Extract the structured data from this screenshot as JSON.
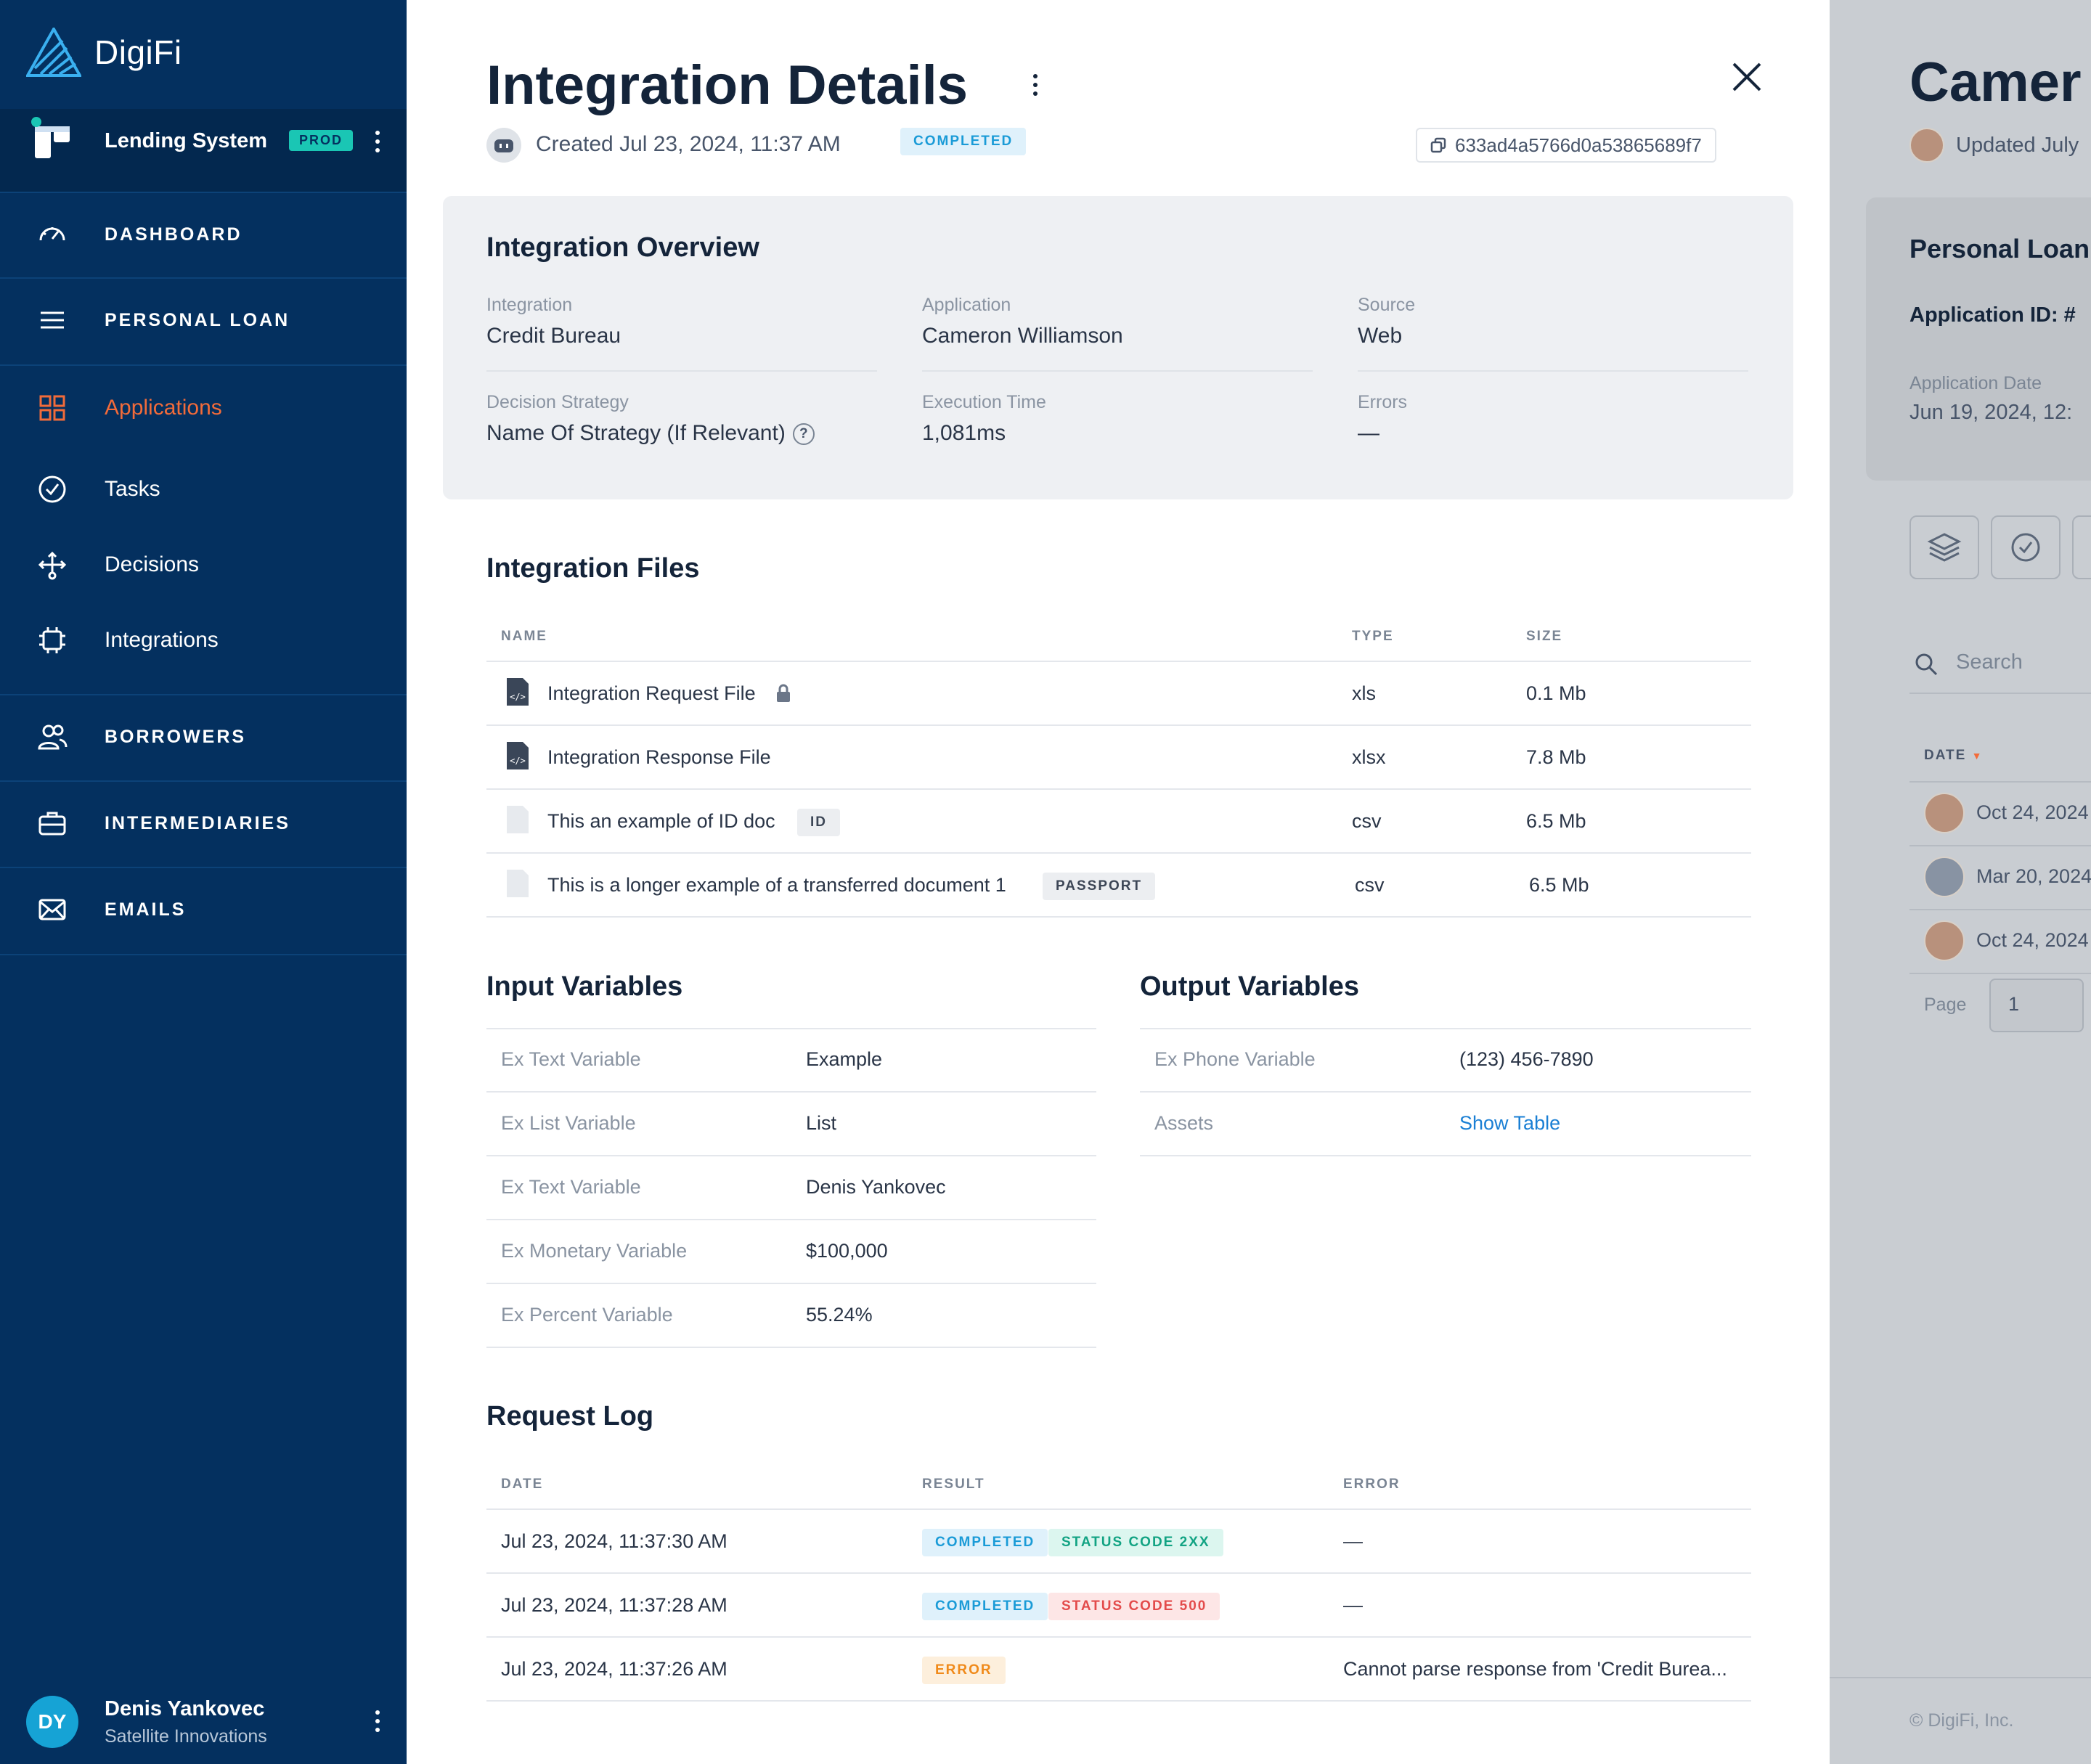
{
  "sidebar": {
    "logo_text": "DigiFi",
    "system_name": "Lending System",
    "system_badge": "PROD",
    "nav": {
      "dashboard": "DASHBOARD",
      "personal_loan": "PERSONAL LOAN",
      "applications": "Applications",
      "tasks": "Tasks",
      "decisions": "Decisions",
      "integrations": "Integrations",
      "borrowers": "BORROWERS",
      "intermediaries": "INTERMEDIARIES",
      "emails": "EMAILS"
    },
    "user": {
      "initials": "DY",
      "name": "Denis Yankovec",
      "org": "Satellite Innovations"
    }
  },
  "detail": {
    "title": "Integration Details",
    "created": "Created Jul 23, 2024, 11:37 AM",
    "status": "COMPLETED",
    "id": "633ad4a5766d0a53865689f7",
    "overview": {
      "title": "Integration Overview",
      "fields": [
        {
          "label": "Integration",
          "value": "Credit Bureau"
        },
        {
          "label": "Application",
          "value": "Cameron Williamson"
        },
        {
          "label": "Source",
          "value": "Web"
        },
        {
          "label": "Decision Strategy",
          "value": "Name Of Strategy (If Relevant)"
        },
        {
          "label": "Execution Time",
          "value": "1,081ms"
        },
        {
          "label": "Errors",
          "value": "—"
        }
      ],
      "help_glyph": "?"
    },
    "files": {
      "title": "Integration Files",
      "headers": [
        "NAME",
        "TYPE",
        "SIZE"
      ],
      "rows": [
        {
          "name": "Integration Request File",
          "type": "xls",
          "size": "0.1 Mb",
          "icon": "code-file-icon",
          "locked": true
        },
        {
          "name": "Integration Response File",
          "type": "xlsx",
          "size": "7.8 Mb",
          "icon": "code-file-icon"
        },
        {
          "name": "This an example of ID doc",
          "type": "csv",
          "size": "6.5 Mb",
          "icon": "blank-file-icon",
          "tag": "ID"
        },
        {
          "name": "This is a longer example of a transferred document 1",
          "type": "csv",
          "size": "6.5 Mb",
          "icon": "blank-file-icon",
          "tag": "PASSPORT"
        }
      ]
    },
    "input_variables": {
      "title": "Input Variables",
      "rows": [
        {
          "name": "Ex Text Variable",
          "value": "Example"
        },
        {
          "name": "Ex List Variable",
          "value": "List"
        },
        {
          "name": "Ex Text Variable",
          "value": "Denis Yankovec"
        },
        {
          "name": "Ex Monetary Variable",
          "value": "$100,000"
        },
        {
          "name": "Ex Percent Variable",
          "value": "55.24%"
        }
      ]
    },
    "output_variables": {
      "title": "Output Variables",
      "rows": [
        {
          "name": "Ex Phone Variable",
          "value": "(123) 456-7890"
        },
        {
          "name": "Assets",
          "value": "Show Table"
        }
      ]
    },
    "request_log": {
      "title": "Request Log",
      "headers": [
        "DATE",
        "RESULT",
        "ERROR"
      ],
      "rows": [
        {
          "date": "Jul 23, 2024, 11:37:30 AM",
          "badges": [
            "COMPLETED",
            "STATUS CODE 2XX"
          ],
          "error": "—"
        },
        {
          "date": "Jul 23, 2024, 11:37:28 AM",
          "badges": [
            "COMPLETED",
            "STATUS CODE 500"
          ],
          "error": "—"
        },
        {
          "date": "Jul 23, 2024, 11:37:26 AM",
          "badges": [
            "ERROR"
          ],
          "error": "Cannot parse response from 'Credit Burea..."
        }
      ]
    }
  },
  "background_page": {
    "title": "Camer",
    "updated": "Updated July",
    "card_title": "Personal Loan",
    "app_id": "Application ID: #",
    "app_date_label": "Application Date",
    "app_date": "Jun 19, 2024, 12:",
    "search_placeholder": "Search",
    "date_header": "DATE",
    "rows": [
      "Oct 24, 2024",
      "Mar 20, 2024",
      "Oct 24, 2024"
    ],
    "page_label": "Page",
    "page_value": "1",
    "footer": "© DigiFi, Inc."
  },
  "colors": {
    "sidebar_bg": "#04305f",
    "accent": "#f26b3a",
    "prod_badge": "#1ac6b4",
    "link": "#1a7fd4"
  }
}
